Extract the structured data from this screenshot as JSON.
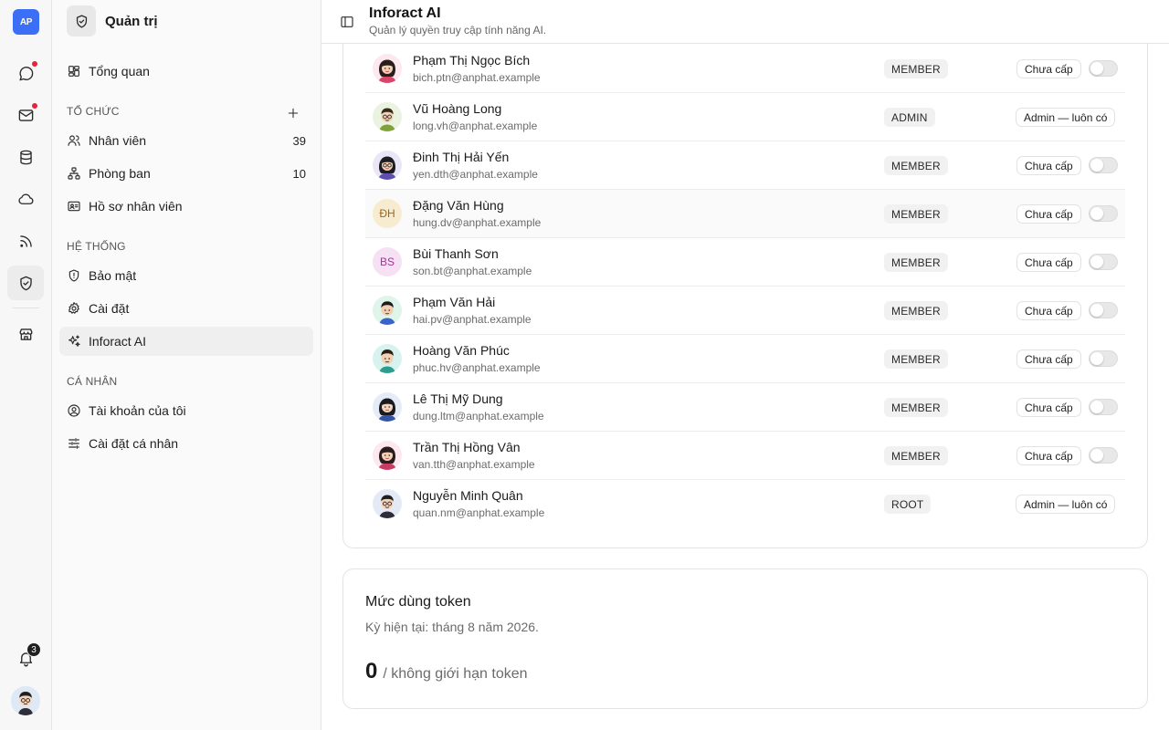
{
  "rail": {
    "logo_text": "AP",
    "notification_count": "3"
  },
  "nav": {
    "title": "Quản trị",
    "overview": "Tổng quan",
    "sections": {
      "org": "TỔ CHỨC",
      "system": "HỆ THỐNG",
      "personal": "CÁ NHÂN"
    },
    "items": {
      "employees": {
        "label": "Nhân viên",
        "count": "39"
      },
      "departments": {
        "label": "Phòng ban",
        "count": "10"
      },
      "profiles": {
        "label": "Hồ sơ nhân viên"
      },
      "security": {
        "label": "Bảo mật"
      },
      "settings": {
        "label": "Cài đặt"
      },
      "ai": {
        "label": "Inforact AI"
      },
      "account": {
        "label": "Tài khoản của tôi"
      },
      "personal_settings": {
        "label": "Cài đặt cá nhân"
      }
    }
  },
  "header": {
    "title": "Inforact AI",
    "subtitle": "Quản lý quyền truy cập tính năng AI."
  },
  "users": [
    {
      "name": "Phạm Thị Ngọc Bích",
      "email": "bich.ptn@anphat.example",
      "role": "MEMBER",
      "status": "Chưa cấp",
      "enabled": false
    },
    {
      "name": "Vũ Hoàng Long",
      "email": "long.vh@anphat.example",
      "role": "ADMIN",
      "status": "Admin — luôn có",
      "enabled": true
    },
    {
      "name": "Đinh Thị Hải Yến",
      "email": "yen.dth@anphat.example",
      "role": "MEMBER",
      "status": "Chưa cấp",
      "enabled": false
    },
    {
      "name": "Đặng Văn Hùng",
      "email": "hung.dv@anphat.example",
      "role": "MEMBER",
      "status": "Chưa cấp",
      "enabled": false,
      "initials": "ĐH"
    },
    {
      "name": "Bùi Thanh Sơn",
      "email": "son.bt@anphat.example",
      "role": "MEMBER",
      "status": "Chưa cấp",
      "enabled": false,
      "initials": "BS"
    },
    {
      "name": "Phạm Văn Hải",
      "email": "hai.pv@anphat.example",
      "role": "MEMBER",
      "status": "Chưa cấp",
      "enabled": false
    },
    {
      "name": "Hoàng Văn Phúc",
      "email": "phuc.hv@anphat.example",
      "role": "MEMBER",
      "status": "Chưa cấp",
      "enabled": false
    },
    {
      "name": "Lê Thị Mỹ Dung",
      "email": "dung.ltm@anphat.example",
      "role": "MEMBER",
      "status": "Chưa cấp",
      "enabled": false
    },
    {
      "name": "Trần Thị Hồng Vân",
      "email": "van.tth@anphat.example",
      "role": "MEMBER",
      "status": "Chưa cấp",
      "enabled": false
    },
    {
      "name": "Nguyễn Minh Quân",
      "email": "quan.nm@anphat.example",
      "role": "ROOT",
      "status": "Admin — luôn có",
      "enabled": true
    }
  ],
  "token_usage": {
    "title": "Mức dùng token",
    "period": "Kỳ hiện tại: tháng 8 năm 2026.",
    "used": "0",
    "limit": "/ không giới hạn token"
  },
  "colors": {
    "accent": "#3b6ff5",
    "alert": "#e5243b"
  }
}
